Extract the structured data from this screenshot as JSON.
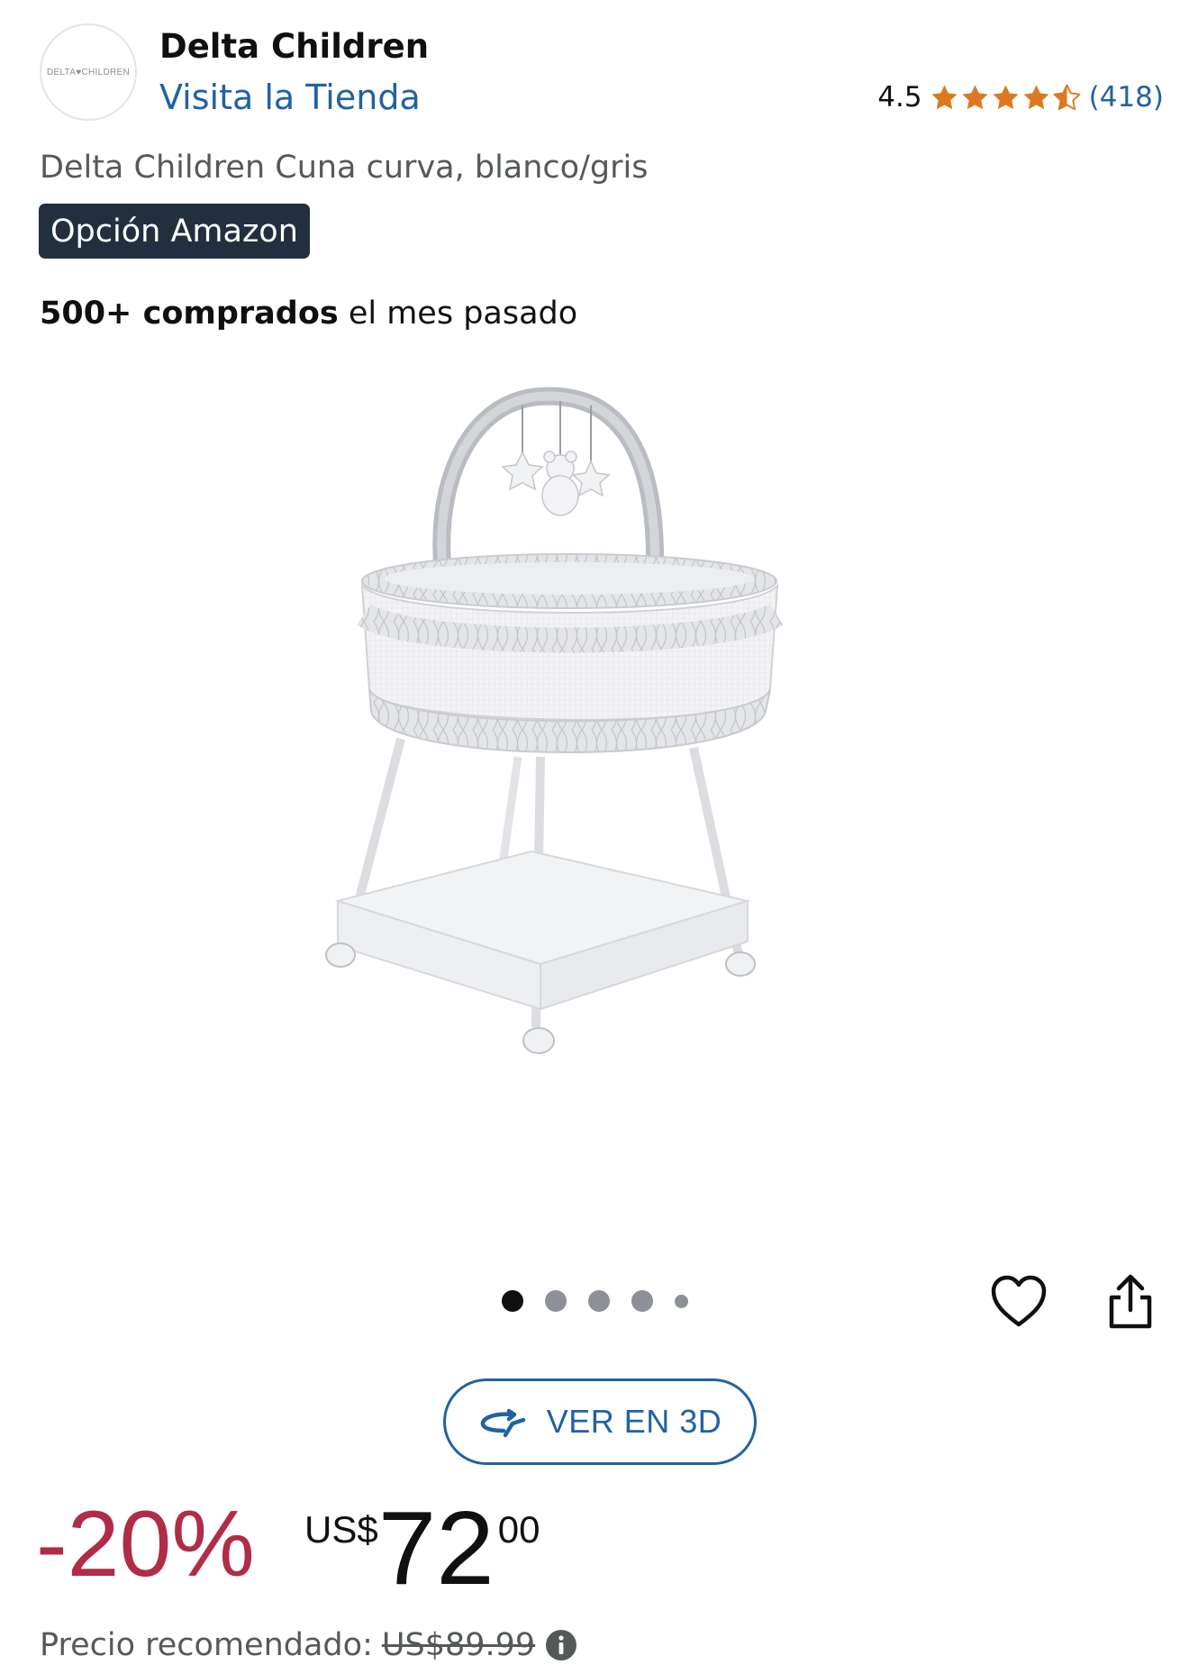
{
  "header": {
    "brand_logo_text": "DELTA♥CHILDREN",
    "brand_name": "Delta Children",
    "store_link": "Visita la Tienda"
  },
  "rating": {
    "value": "4.5",
    "stars": 4.5,
    "count": "(418)",
    "star_color": "#de7921"
  },
  "product": {
    "title": "Delta Children Cuna curva, blanco/gris",
    "badge": "Opción Amazon",
    "bought_bold": "500+ comprados",
    "bought_rest": " el mes pasado"
  },
  "gallery": {
    "total_images": 5,
    "active_index": 0,
    "wishlist_icon": "heart-icon",
    "share_icon": "share-icon"
  },
  "view3d": {
    "label": "VER EN 3D",
    "icon": "rotate-3d-icon"
  },
  "pricing": {
    "discount": "-20%",
    "currency": "US$",
    "whole": "72",
    "fraction": "00",
    "list_label": "Precio recomendado:",
    "list_value": "US$89.99",
    "discount_color": "#b12c47",
    "link_color": "#2162a1"
  }
}
